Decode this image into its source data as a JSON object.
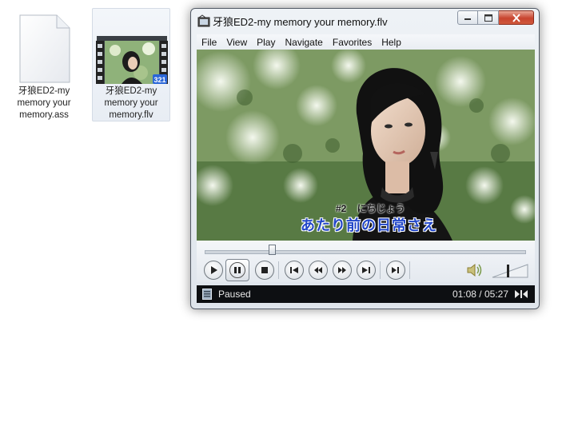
{
  "desktop": {
    "files": [
      {
        "name": "牙狼ED2-my memory your memory.ass",
        "line1": "牙狼ED2-my",
        "line2": "memory your",
        "line3": "memory.ass",
        "selected": false,
        "icon": "document-icon"
      },
      {
        "name": "牙狼ED2-my memory your memory.flv",
        "line1": "牙狼ED2-my",
        "line2": "memory your",
        "line3": "memory.flv",
        "selected": true,
        "icon": "video-thumbnail-icon",
        "badge": "321"
      }
    ]
  },
  "player": {
    "title": "牙狼ED2-my memory your memory.flv",
    "menu": [
      "File",
      "View",
      "Play",
      "Navigate",
      "Favorites",
      "Help"
    ],
    "subtitle_ruby": "#2    にちじょう",
    "subtitle_main": "あたり前の日常さえ",
    "seek_fraction": 0.21,
    "status": "Paused",
    "time": "01:08 / 05:27"
  },
  "colors": {
    "close_button": "#c8442f",
    "status_bar": "#0d0f12",
    "subtitle": "#2347c8"
  }
}
